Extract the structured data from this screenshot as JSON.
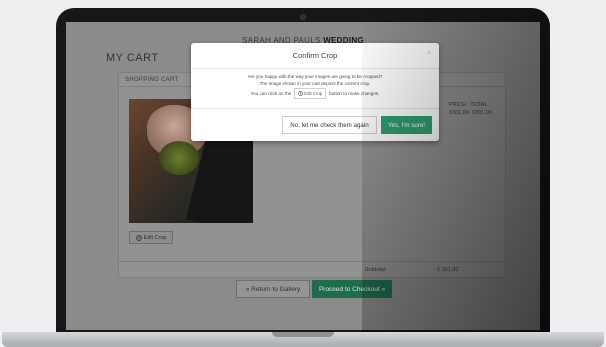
{
  "site": {
    "title_prefix": "SARAH AND PAULS",
    "title_bold": "WEDDING"
  },
  "page": {
    "heading": "MY CART"
  },
  "cart": {
    "header": "SHOPPING CART",
    "edit_crop_label": "Edit Crop",
    "price_header": "PRICE:",
    "total_header": "TOTAL:",
    "price_value": "€301.00",
    "total_value": "€301.00",
    "subtotal_label": "Subtotal:",
    "subtotal_value": "€ 301.00"
  },
  "actions": {
    "return_label": "« Return to Gallery",
    "checkout_label": "Proceed to Checkout »"
  },
  "modal": {
    "title": "Confirm Crop",
    "close": "×",
    "line1": "Are you happy with the way your images are going to be cropped?",
    "line2": "The image shown in your cart depicts the current crop.",
    "line3_before": "You can click on the",
    "edit_crop_label": "Edit Crop",
    "line3_after": "button to make changes.",
    "no_label": "No, let me check them again",
    "yes_label": "Yes, I'm sure!"
  },
  "colors": {
    "accent_green": "#2f9e70",
    "dim_green": "#1f6c4d",
    "overlay": "#8b8b8b"
  },
  "icons": {
    "edit": "crop-icon"
  }
}
